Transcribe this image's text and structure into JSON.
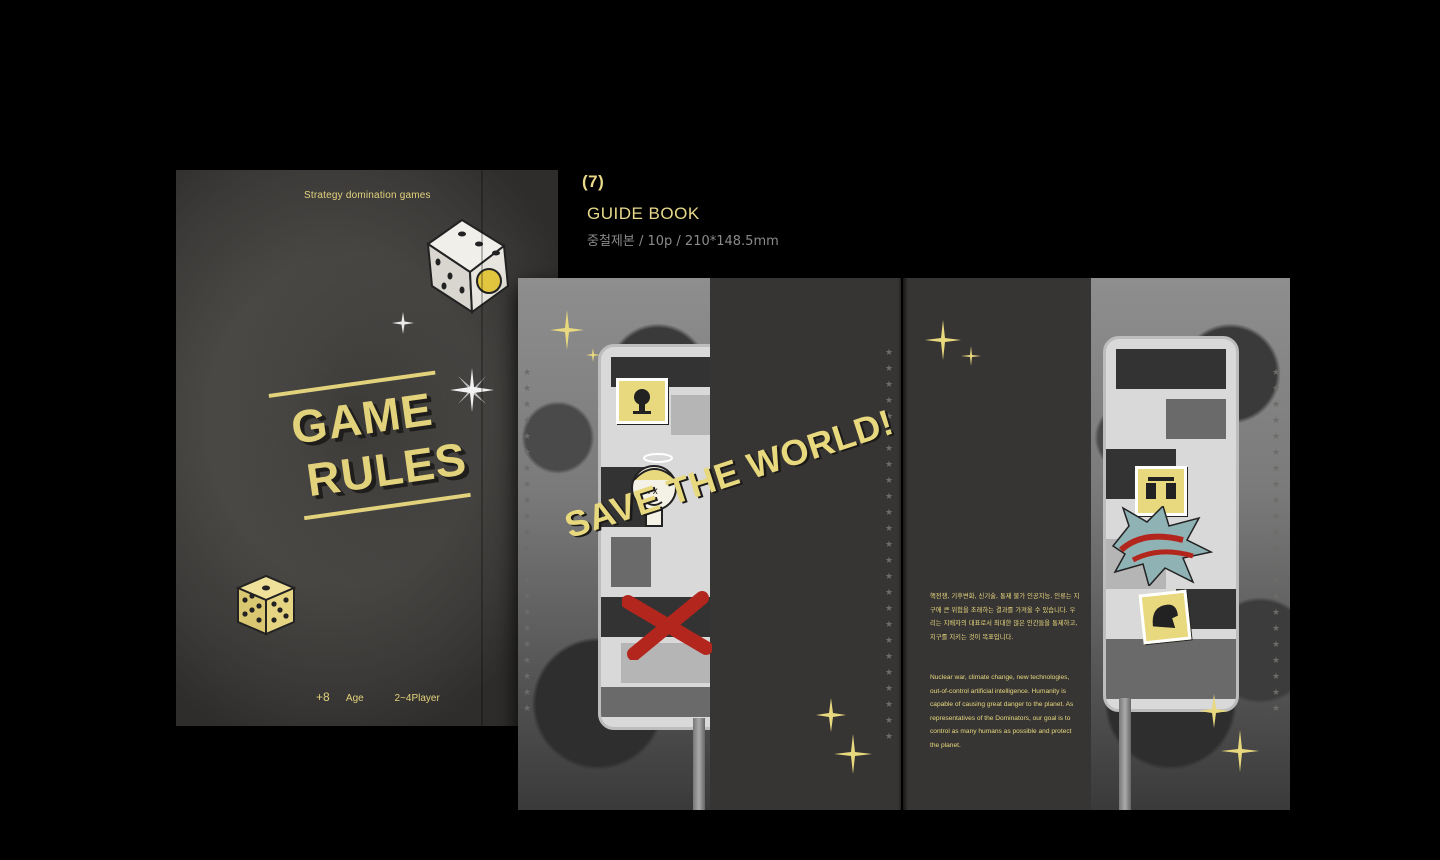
{
  "caption": {
    "number": "(7)",
    "title": "GUIDE BOOK",
    "spec": "중철제본 / 10p / 210*148.5mm"
  },
  "cover": {
    "tagline": "Strategy domination games",
    "title_line1": "GAME",
    "title_line2": "RULES",
    "age_num": "+8",
    "age_label": "Age",
    "players": "2~4Player"
  },
  "spread": {
    "headline": "SAVE THE WORLD!",
    "korean_text": "핵전쟁, 기후변화, 신기술, 통제 불가 인공지능. 인류는 지구에 큰 위험을 초래하는 결과를 가져올 수 있습니다. 우리는 지배자의 대표로서 최대한 많은 인간들을 통제하고, 지구를 지키는 것이 목표입니다.",
    "english_text": "Nuclear war, climate change, new technologies, out-of-control artificial intelligence. Humanity is capable of causing great danger to the planet. As representatives of the Dominators, our goal is to control as many humans as possible and protect the planet."
  },
  "colors": {
    "accent_yellow": "#e8d87e",
    "background": "#000000",
    "cover_gray": "#4a4845",
    "page_dark": "#373534",
    "red_x": "#b3261e"
  },
  "icons": [
    "dice-icon",
    "sparkle-icon",
    "star-icon",
    "red-x-mark",
    "sticker-icon"
  ]
}
